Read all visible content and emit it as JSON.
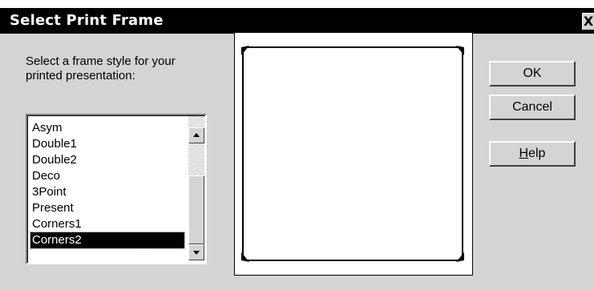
{
  "window": {
    "title": "Select Print Frame",
    "close_label": "X"
  },
  "prompt": {
    "line1": "Select a frame style for your",
    "line2": "printed presentation:"
  },
  "frame_list": {
    "items": [
      "Asym",
      "Double1",
      "Double2",
      "Deco",
      "3Point",
      "Present",
      "Corners1",
      "Corners2"
    ],
    "selected": "Corners2"
  },
  "buttons": {
    "ok": "OK",
    "cancel": "Cancel",
    "help_mnemonic": "H",
    "help_rest": "elp"
  },
  "colors": {
    "face": "#d4d4d4",
    "titlebar": "#000000",
    "selection": "#000000"
  }
}
